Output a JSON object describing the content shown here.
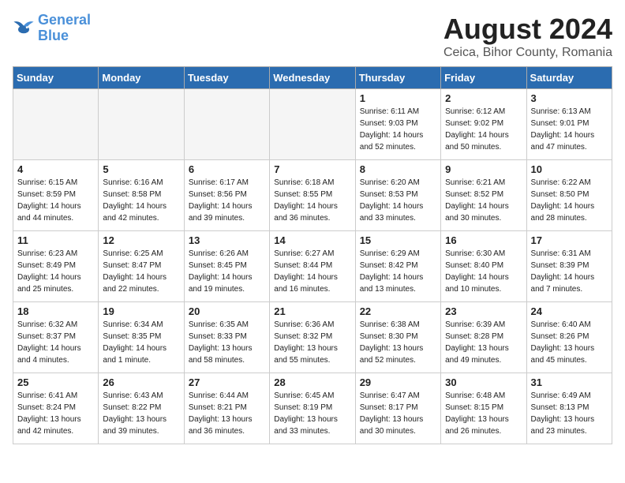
{
  "header": {
    "logo_line1": "General",
    "logo_line2": "Blue",
    "month_year": "August 2024",
    "location": "Ceica, Bihor County, Romania"
  },
  "days_of_week": [
    "Sunday",
    "Monday",
    "Tuesday",
    "Wednesday",
    "Thursday",
    "Friday",
    "Saturday"
  ],
  "weeks": [
    [
      {
        "day": "",
        "info": ""
      },
      {
        "day": "",
        "info": ""
      },
      {
        "day": "",
        "info": ""
      },
      {
        "day": "",
        "info": ""
      },
      {
        "day": "1",
        "info": "Sunrise: 6:11 AM\nSunset: 9:03 PM\nDaylight: 14 hours\nand 52 minutes."
      },
      {
        "day": "2",
        "info": "Sunrise: 6:12 AM\nSunset: 9:02 PM\nDaylight: 14 hours\nand 50 minutes."
      },
      {
        "day": "3",
        "info": "Sunrise: 6:13 AM\nSunset: 9:01 PM\nDaylight: 14 hours\nand 47 minutes."
      }
    ],
    [
      {
        "day": "4",
        "info": "Sunrise: 6:15 AM\nSunset: 8:59 PM\nDaylight: 14 hours\nand 44 minutes."
      },
      {
        "day": "5",
        "info": "Sunrise: 6:16 AM\nSunset: 8:58 PM\nDaylight: 14 hours\nand 42 minutes."
      },
      {
        "day": "6",
        "info": "Sunrise: 6:17 AM\nSunset: 8:56 PM\nDaylight: 14 hours\nand 39 minutes."
      },
      {
        "day": "7",
        "info": "Sunrise: 6:18 AM\nSunset: 8:55 PM\nDaylight: 14 hours\nand 36 minutes."
      },
      {
        "day": "8",
        "info": "Sunrise: 6:20 AM\nSunset: 8:53 PM\nDaylight: 14 hours\nand 33 minutes."
      },
      {
        "day": "9",
        "info": "Sunrise: 6:21 AM\nSunset: 8:52 PM\nDaylight: 14 hours\nand 30 minutes."
      },
      {
        "day": "10",
        "info": "Sunrise: 6:22 AM\nSunset: 8:50 PM\nDaylight: 14 hours\nand 28 minutes."
      }
    ],
    [
      {
        "day": "11",
        "info": "Sunrise: 6:23 AM\nSunset: 8:49 PM\nDaylight: 14 hours\nand 25 minutes."
      },
      {
        "day": "12",
        "info": "Sunrise: 6:25 AM\nSunset: 8:47 PM\nDaylight: 14 hours\nand 22 minutes."
      },
      {
        "day": "13",
        "info": "Sunrise: 6:26 AM\nSunset: 8:45 PM\nDaylight: 14 hours\nand 19 minutes."
      },
      {
        "day": "14",
        "info": "Sunrise: 6:27 AM\nSunset: 8:44 PM\nDaylight: 14 hours\nand 16 minutes."
      },
      {
        "day": "15",
        "info": "Sunrise: 6:29 AM\nSunset: 8:42 PM\nDaylight: 14 hours\nand 13 minutes."
      },
      {
        "day": "16",
        "info": "Sunrise: 6:30 AM\nSunset: 8:40 PM\nDaylight: 14 hours\nand 10 minutes."
      },
      {
        "day": "17",
        "info": "Sunrise: 6:31 AM\nSunset: 8:39 PM\nDaylight: 14 hours\nand 7 minutes."
      }
    ],
    [
      {
        "day": "18",
        "info": "Sunrise: 6:32 AM\nSunset: 8:37 PM\nDaylight: 14 hours\nand 4 minutes."
      },
      {
        "day": "19",
        "info": "Sunrise: 6:34 AM\nSunset: 8:35 PM\nDaylight: 14 hours\nand 1 minute."
      },
      {
        "day": "20",
        "info": "Sunrise: 6:35 AM\nSunset: 8:33 PM\nDaylight: 13 hours\nand 58 minutes."
      },
      {
        "day": "21",
        "info": "Sunrise: 6:36 AM\nSunset: 8:32 PM\nDaylight: 13 hours\nand 55 minutes."
      },
      {
        "day": "22",
        "info": "Sunrise: 6:38 AM\nSunset: 8:30 PM\nDaylight: 13 hours\nand 52 minutes."
      },
      {
        "day": "23",
        "info": "Sunrise: 6:39 AM\nSunset: 8:28 PM\nDaylight: 13 hours\nand 49 minutes."
      },
      {
        "day": "24",
        "info": "Sunrise: 6:40 AM\nSunset: 8:26 PM\nDaylight: 13 hours\nand 45 minutes."
      }
    ],
    [
      {
        "day": "25",
        "info": "Sunrise: 6:41 AM\nSunset: 8:24 PM\nDaylight: 13 hours\nand 42 minutes."
      },
      {
        "day": "26",
        "info": "Sunrise: 6:43 AM\nSunset: 8:22 PM\nDaylight: 13 hours\nand 39 minutes."
      },
      {
        "day": "27",
        "info": "Sunrise: 6:44 AM\nSunset: 8:21 PM\nDaylight: 13 hours\nand 36 minutes."
      },
      {
        "day": "28",
        "info": "Sunrise: 6:45 AM\nSunset: 8:19 PM\nDaylight: 13 hours\nand 33 minutes."
      },
      {
        "day": "29",
        "info": "Sunrise: 6:47 AM\nSunset: 8:17 PM\nDaylight: 13 hours\nand 30 minutes."
      },
      {
        "day": "30",
        "info": "Sunrise: 6:48 AM\nSunset: 8:15 PM\nDaylight: 13 hours\nand 26 minutes."
      },
      {
        "day": "31",
        "info": "Sunrise: 6:49 AM\nSunset: 8:13 PM\nDaylight: 13 hours\nand 23 minutes."
      }
    ]
  ]
}
